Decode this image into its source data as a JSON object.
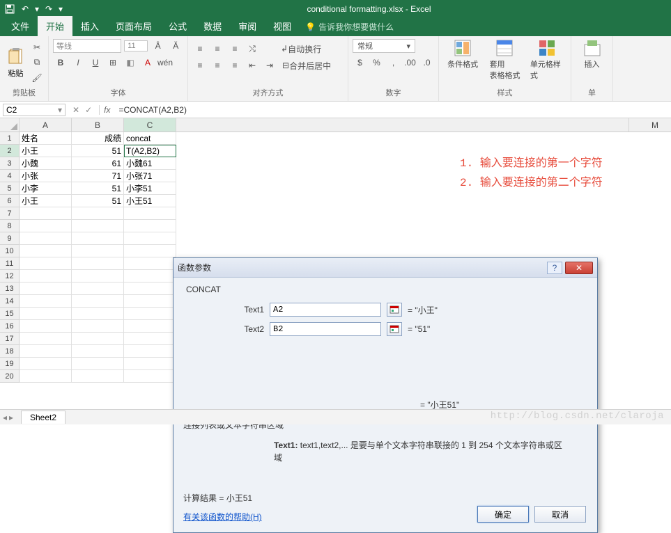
{
  "app_title": "conditional formatting.xlsx - Excel",
  "tabs": {
    "file": "文件",
    "home": "开始",
    "insert": "插入",
    "layout": "页面布局",
    "formulas": "公式",
    "data": "数据",
    "review": "审阅",
    "view": "视图"
  },
  "tellme": "告诉我你想要做什么",
  "ribbon": {
    "paste": "粘贴",
    "clipboard": "剪贴板",
    "font_name": "等线",
    "font_size": "11",
    "font_group": "字体",
    "wrap": "自动换行",
    "merge": "合并后居中",
    "align_group": "对齐方式",
    "number_format": "常规",
    "number_group": "数字",
    "cond_fmt": "条件格式",
    "table_fmt": "套用\n表格格式",
    "cell_styles": "单元格样式",
    "styles_group": "样式",
    "insert": "插入",
    "cells_group": "单"
  },
  "namebox": "C2",
  "formula": "=CONCAT(A2,B2)",
  "columns": [
    "A",
    "B",
    "C",
    "M"
  ],
  "headers": {
    "A": "姓名",
    "B": "成绩",
    "C": "concat"
  },
  "rows": [
    {
      "n": 1
    },
    {
      "n": 2,
      "A": "小王",
      "B": 51,
      "C": "T(A2,B2)"
    },
    {
      "n": 3,
      "A": "小魏",
      "B": 61,
      "C": "小魏61"
    },
    {
      "n": 4,
      "A": "小张",
      "B": 71,
      "C": "小张71"
    },
    {
      "n": 5,
      "A": "小李",
      "B": 51,
      "C": "小李51"
    },
    {
      "n": 6,
      "A": "小王",
      "B": 51,
      "C": "小王51"
    },
    {
      "n": 7
    },
    {
      "n": 8
    },
    {
      "n": 9
    },
    {
      "n": 10
    },
    {
      "n": 11
    },
    {
      "n": 12
    },
    {
      "n": 13
    },
    {
      "n": 14
    },
    {
      "n": 15
    },
    {
      "n": 16
    },
    {
      "n": 17
    },
    {
      "n": 18
    },
    {
      "n": 19
    },
    {
      "n": 20
    }
  ],
  "dialog": {
    "title": "函数参数",
    "func": "CONCAT",
    "args": [
      {
        "label": "Text1",
        "value": "A2",
        "result": "= \"小王\""
      },
      {
        "label": "Text2",
        "value": "B2",
        "result": "= \"51\""
      }
    ],
    "mid_result": "= \"小王51\"",
    "desc": "连接列表或文本字符串区域",
    "arg_help_label": "Text1:",
    "arg_help": "text1,text2,... 是要与单个文本字符串联接的 1 到 254 个文本字符串或区域",
    "calc_label": "计算结果 = ",
    "calc_value": "小王51",
    "help_link": "有关该函数的帮助(H)",
    "ok": "确定",
    "cancel": "取消"
  },
  "annotations": {
    "a1": "1. 输入要连接的第一个字符",
    "a2": "2. 输入要连接的第二个字符"
  },
  "sheet": "Sheet2",
  "watermark": "http://blog.csdn.net/claroja"
}
